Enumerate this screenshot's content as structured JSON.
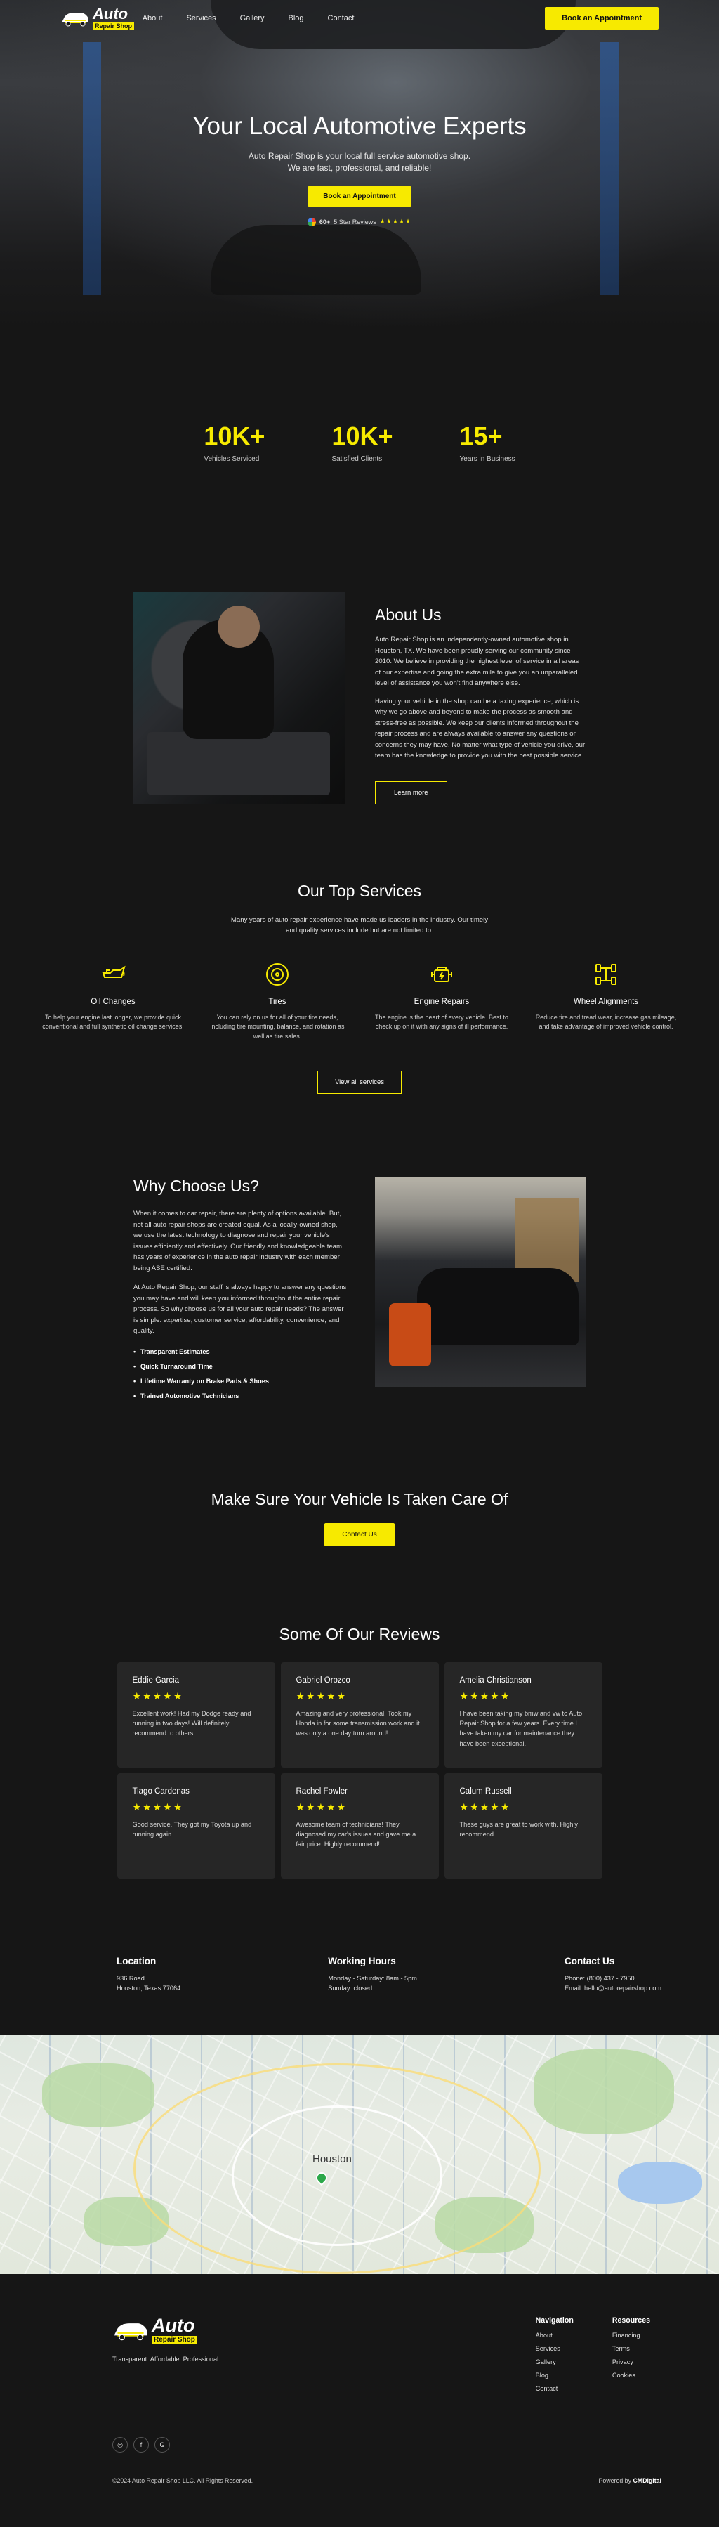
{
  "brand": {
    "name": "Auto",
    "sub": "Repair Shop",
    "tagline": "Transparent. Affordable. Professional."
  },
  "nav": [
    "About",
    "Services",
    "Gallery",
    "Blog",
    "Contact"
  ],
  "header_cta": "Book an Appointment",
  "hero": {
    "title": "Your Local Automotive Experts",
    "subtitle": "Auto Repair Shop is your local full service automotive shop. We are fast, professional, and reliable!",
    "cta": "Book an Appointment",
    "reviews_count": "60+",
    "reviews_label": "5 Star Reviews",
    "stars": "★★★★★"
  },
  "stats": [
    {
      "num": "10K+",
      "label": "Vehicles Serviced"
    },
    {
      "num": "10K+",
      "label": "Satisfied Clients"
    },
    {
      "num": "15+",
      "label": "Years in Business"
    }
  ],
  "about": {
    "title": "About Us",
    "p1": "Auto Repair Shop is an independently-owned automotive shop in Houston, TX. We have been proudly serving our community since 2010. We believe in providing the highest level of service in all areas of our expertise and going the extra mile to give you an unparalleled level of assistance you won't find anywhere else.",
    "p2": "Having your vehicle in the shop can be a taxing experience, which is why we go above and beyond to make the process as smooth and stress-free as possible. We keep our clients informed throughout the repair process and are always available to answer any questions or concerns they may have. No matter what type of vehicle you drive, our team has the knowledge to provide you with the best possible service.",
    "cta": "Learn more"
  },
  "services": {
    "title": "Our Top Services",
    "intro": "Many years of auto repair experience have made us leaders in the industry. Our timely and quality services include but are not limited to:",
    "items": [
      {
        "icon": "oil-can-icon",
        "title": "Oil Changes",
        "desc": "To help your engine last longer, we provide quick conventional and full synthetic oil change services."
      },
      {
        "icon": "tire-icon",
        "title": "Tires",
        "desc": "You can rely on us for all of your tire needs, including tire mounting, balance, and rotation as well as tire sales."
      },
      {
        "icon": "engine-icon",
        "title": "Engine Repairs",
        "desc": "The engine is the heart of every vehicle. Best to check up on it with any signs of ill performance."
      },
      {
        "icon": "wheel-alignment-icon",
        "title": "Wheel Alignments",
        "desc": "Reduce tire and tread wear, increase gas mileage, and take advantage of improved vehicle control."
      }
    ],
    "cta": "View all services"
  },
  "why": {
    "title": "Why Choose Us?",
    "p1": "When it comes to car repair, there are plenty of options available. But, not all auto repair shops are created equal. As a locally-owned shop, we use the latest technology to diagnose and repair your vehicle's issues efficiently and effectively. Our friendly and knowledgeable team has years of experience in the auto repair industry with each member being ASE certified.",
    "p2": "At Auto Repair Shop, our staff is always happy to answer any questions you may have and will keep you informed throughout the entire repair process. So why choose us for all your auto repair needs? The answer is simple: expertise, customer service, affordability, convenience, and quality.",
    "list": [
      "Transparent Estimates",
      "Quick Turnaround Time",
      "Lifetime Warranty on Brake Pads & Shoes",
      "Trained Automotive Technicians"
    ]
  },
  "cta": {
    "title": "Make Sure Your Vehicle Is Taken Care Of",
    "button": "Contact Us"
  },
  "reviews": {
    "title": "Some Of Our Reviews",
    "items": [
      {
        "name": "Eddie Garcia",
        "text": "Excellent work! Had my Dodge ready and running in two days! Will definitely recommend to others!"
      },
      {
        "name": "Gabriel Orozco",
        "text": "Amazing and very professional. Took my Honda in for some transmission work and it was only a one day turn around!"
      },
      {
        "name": "Amelia Christianson",
        "text": "I have been taking my bmw and vw to Auto Repair Shop for a few years. Every time I have taken my car for maintenance they have been exceptional."
      },
      {
        "name": "Tiago Cardenas",
        "text": "Good service. They got my Toyota up and running again."
      },
      {
        "name": "Rachel Fowler",
        "text": "Awesome team of technicians! They diagnosed my car's issues and gave me a fair price. Highly recommend!"
      },
      {
        "name": "Calum Russell",
        "text": "These guys are great to work with. Highly recommend."
      }
    ],
    "stars": "★★★★★"
  },
  "info": {
    "location_title": "Location",
    "address1": "936 Road",
    "address2": "Houston, Texas 77064",
    "hours_title": "Working Hours",
    "hours1": "Monday - Saturday: 8am - 5pm",
    "hours2": "Sunday: closed",
    "contact_title": "Contact Us",
    "phone": "Phone: (800) 437 - 7950",
    "email": "Email: hello@autorepairshop.com"
  },
  "map": {
    "city": "Houston"
  },
  "footer": {
    "nav_title": "Navigation",
    "nav": [
      "About",
      "Services",
      "Gallery",
      "Blog",
      "Contact"
    ],
    "res_title": "Resources",
    "resources": [
      "Financing",
      "Terms",
      "Privacy",
      "Cookies"
    ],
    "socials": [
      "instagram-icon",
      "facebook-icon",
      "google-icon"
    ],
    "copyright": "©2024 Auto Repair Shop LLC. All Rights Reserved.",
    "powered_prefix": "Powered by",
    "powered_by": "CMDigital"
  },
  "colors": {
    "accent": "#f7ea00",
    "background": "#161616",
    "card": "#262626"
  }
}
